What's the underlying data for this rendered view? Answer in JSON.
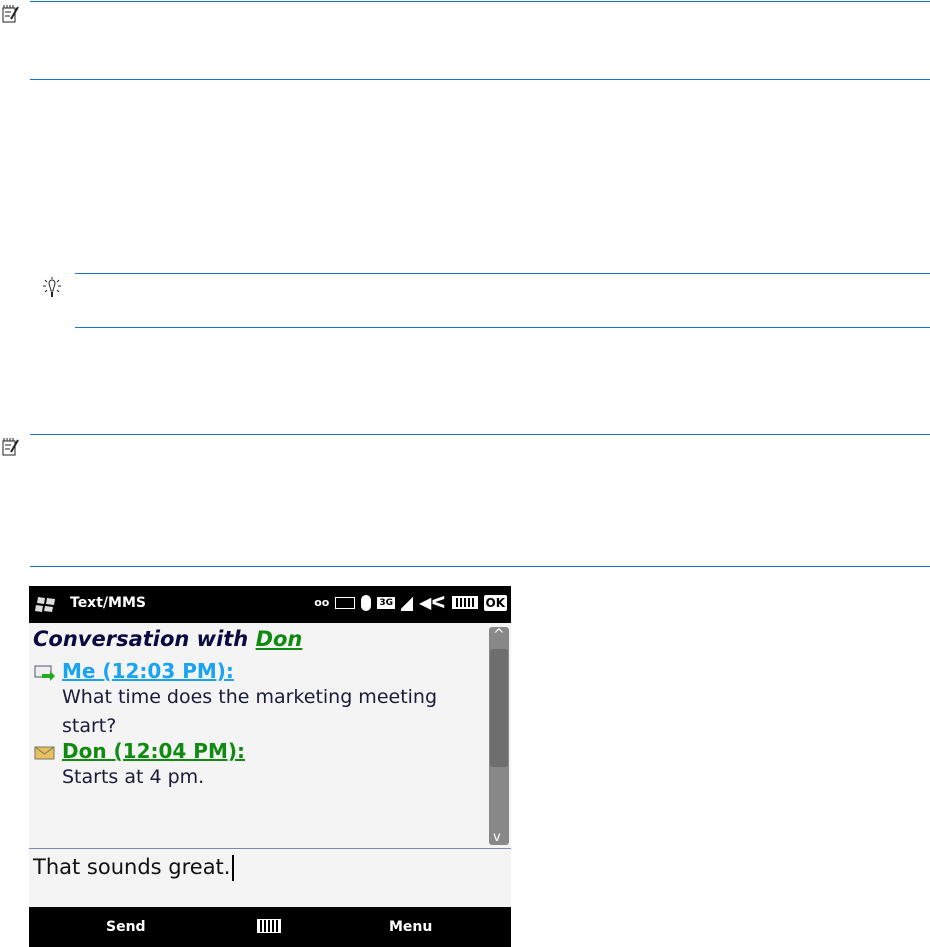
{
  "phone": {
    "title": "Text/MMS",
    "status": {
      "network": "3G",
      "ok_label": "OK"
    },
    "conversation_label": "Conversation with",
    "contact": "Don",
    "messages": [
      {
        "header": "Me (12:03 PM):",
        "body": "What time does the marketing meeting start?",
        "color": "#1aa3f0"
      },
      {
        "header": "Don (12:04 PM):",
        "body": "Starts at 4 pm.",
        "color": "#118a11"
      }
    ],
    "input_value": "That sounds great.",
    "softkeys": {
      "left": "Send",
      "right": "Menu"
    }
  },
  "colors": {
    "rule": "#1a6fe0"
  }
}
